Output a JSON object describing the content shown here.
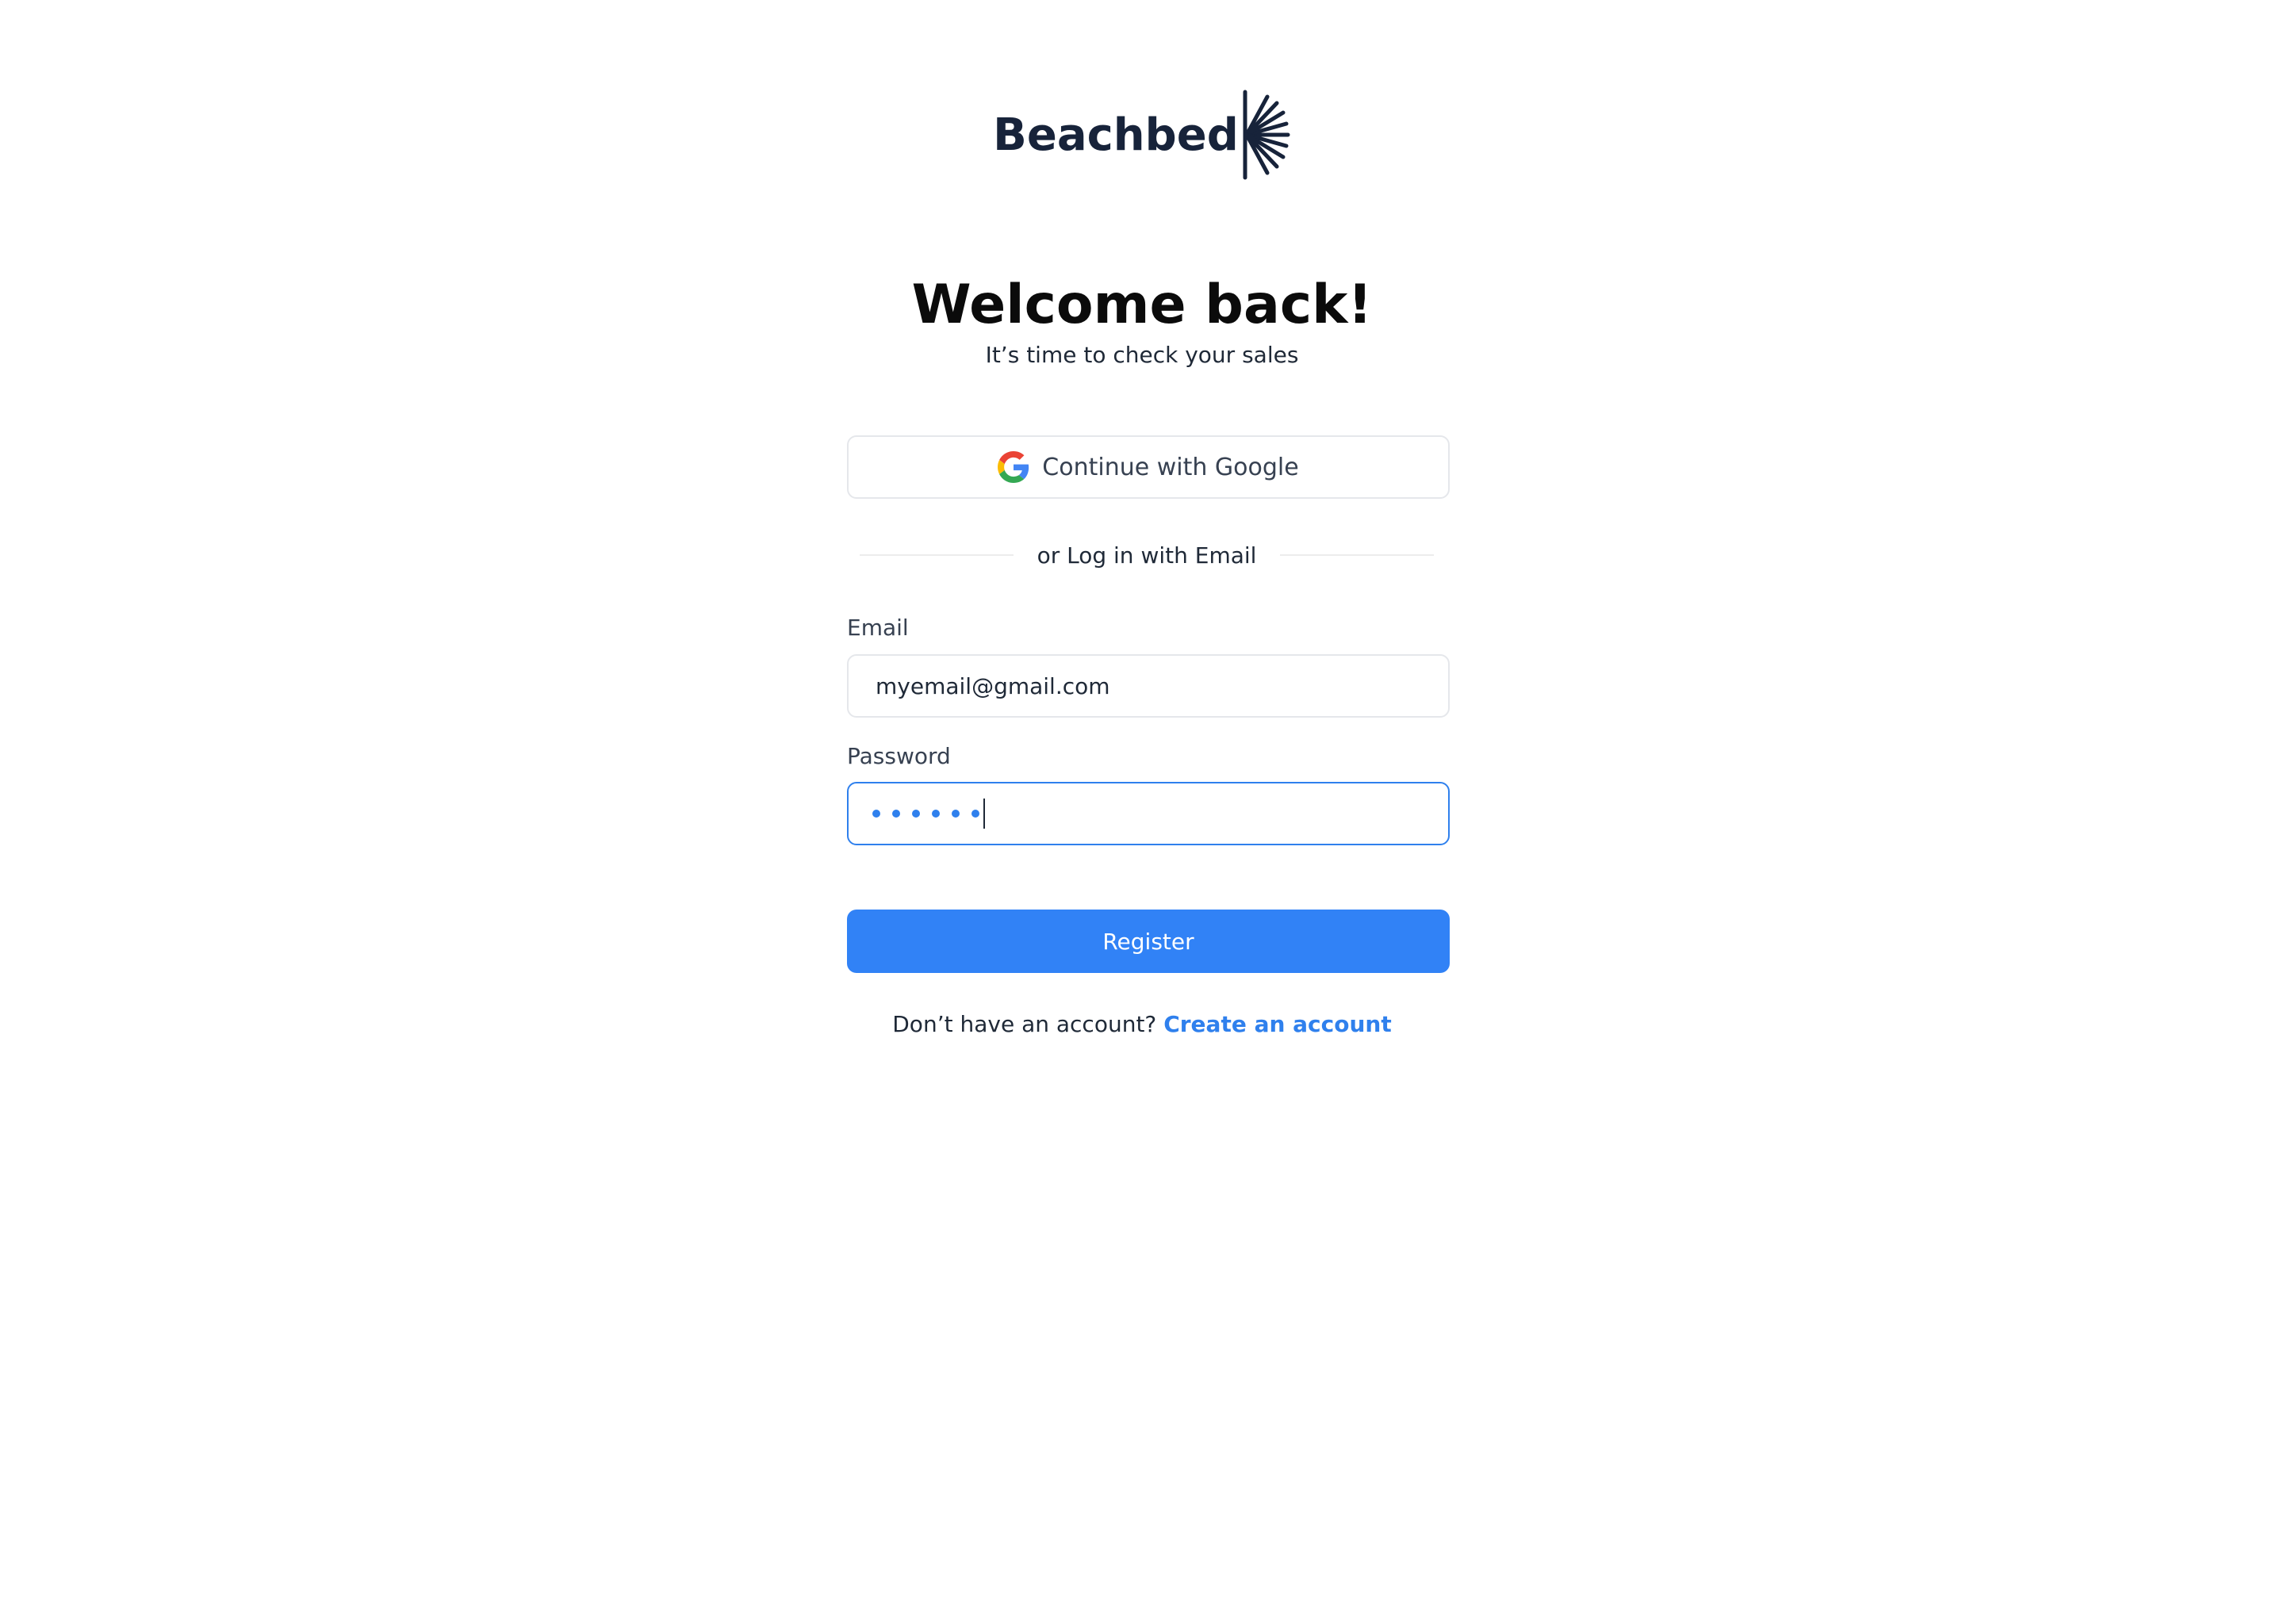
{
  "brand": {
    "name": "Beachbed",
    "color": "#17233a"
  },
  "header": {
    "title": "Welcome back!",
    "subtitle": "It’s time to check your sales"
  },
  "google": {
    "label": "Continue with Google"
  },
  "divider": {
    "text": "or Log in with Email"
  },
  "email": {
    "label": "Email",
    "value": "myemail@gmail.com"
  },
  "password": {
    "label": "Password",
    "masked_length": 6
  },
  "register": {
    "label": "Register"
  },
  "signup": {
    "prompt": "Don’t  have an account?",
    "link": "Create an account"
  },
  "colors": {
    "accent": "#3182f6",
    "focus_border": "#2f80ed",
    "border": "#e5e7eb"
  }
}
